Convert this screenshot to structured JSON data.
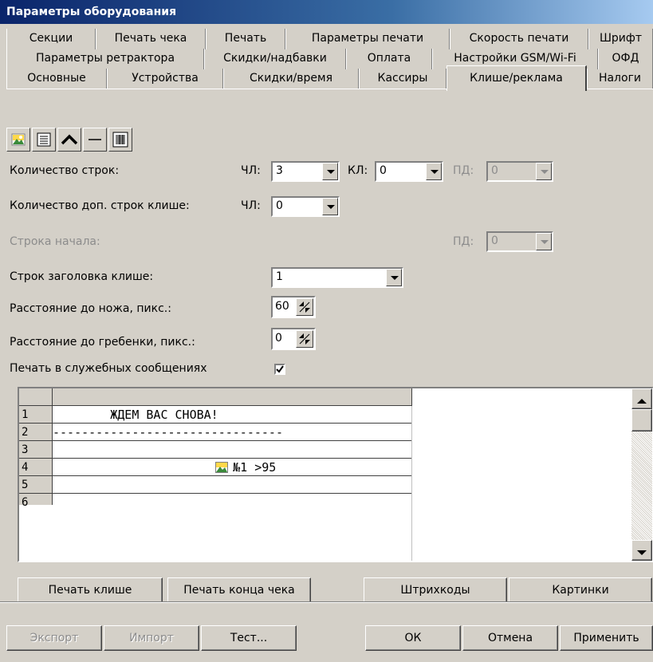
{
  "window": {
    "title": "Параметры оборудования"
  },
  "tabs": {
    "row1": [
      "Секции",
      "Печать чека",
      "Печать",
      "Параметры печати",
      "Скорость печати",
      "Шрифт"
    ],
    "row2": [
      "Параметры ретрактора",
      "Скидки/надбавки",
      "Оплата",
      "Настройки GSM/Wi-Fi",
      "ОФД"
    ],
    "row3": [
      "Основные",
      "Устройства",
      "Скидки/время",
      "Кассиры",
      "Клише/реклама",
      "Налоги"
    ],
    "active": "Клише/реклама"
  },
  "toolbar": {
    "icons": [
      "image-icon",
      "text-lines-icon",
      "arc-icon",
      "line-icon",
      "barcode-icon"
    ]
  },
  "form": {
    "lines_count": {
      "label": "Количество строк:",
      "chl_label": "ЧЛ:",
      "chl_value": "3",
      "kl_label": "КЛ:",
      "kl_value": "0",
      "pd_label": "ПД:",
      "pd_value": "0"
    },
    "extra_lines": {
      "label": "Количество доп. строк клише:",
      "chl_label": "ЧЛ:",
      "chl_value": "0"
    },
    "start_line": {
      "label": "Строка начала:",
      "pd_label": "ПД:",
      "pd_value": "0"
    },
    "header_lines": {
      "label": "Строк заголовка клише:",
      "value": "1"
    },
    "knife_distance": {
      "label": "Расстояние до ножа, пикс.:",
      "value": "60"
    },
    "comb_distance": {
      "label": "Расстояние до гребенки, пикс.:",
      "value": "0"
    },
    "print_service": {
      "label": "Печать в служебных сообщениях",
      "checked": true
    }
  },
  "grid": {
    "rows": [
      {
        "num": "1",
        "text": "        ЖДЕМ ВАС СНОВА!"
      },
      {
        "num": "2",
        "text": "--------------------------------"
      },
      {
        "num": "3",
        "text": "№1 >95"
      },
      {
        "num": "4",
        "text": ""
      },
      {
        "num": "5",
        "text": ""
      },
      {
        "num": "6",
        "text": ""
      }
    ]
  },
  "actions": {
    "print_cliche": "Печать клише",
    "print_end": "Печать конца чека",
    "barcodes": "Штрихкоды",
    "pictures": "Картинки"
  },
  "footer": {
    "export": "Экспорт",
    "import": "Импорт",
    "test": "Тест...",
    "ok": "ОК",
    "cancel": "Отмена",
    "apply": "Применить"
  }
}
